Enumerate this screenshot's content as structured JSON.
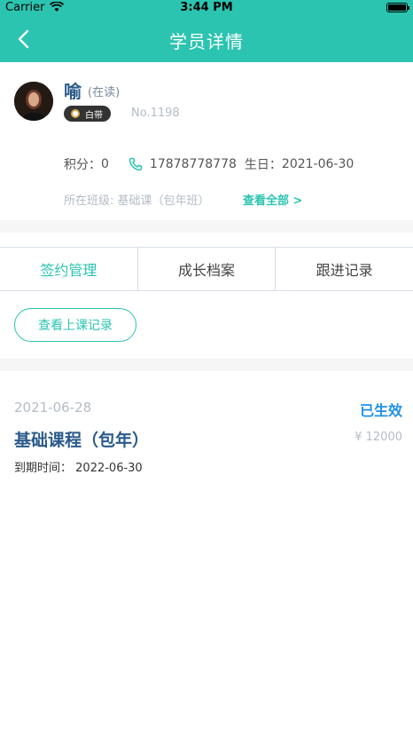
{
  "status_bar": {
    "carrier": "Carrier",
    "time": "3:44 PM"
  },
  "nav": {
    "title": "学员详情"
  },
  "student": {
    "name": "喻",
    "status": "(在读)",
    "belt": "白带",
    "number": "No.1198",
    "points_label": "积分：",
    "points": "0",
    "phone": "17878778778",
    "birthday_label": "生日：",
    "birthday": "2021-06-30",
    "class_label": "所在班级:",
    "class_value": "基础课（包年班）",
    "view_all": "查看全部 >"
  },
  "tabs": [
    {
      "label": "签约管理",
      "active": true
    },
    {
      "label": "成长档案",
      "active": false
    },
    {
      "label": "跟进记录",
      "active": false
    }
  ],
  "record_button": "查看上课记录",
  "contract": {
    "date": "2021-06-28",
    "status": "已生效",
    "title": "基础课程（包年）",
    "price": "¥ 12000",
    "expire_label": "到期时间：",
    "expire_date": "2022-06-30"
  },
  "colors": {
    "accent": "#2bc4b0",
    "title_blue": "#2a5a8a",
    "status_blue": "#1e90e6"
  },
  "icons": {
    "back": "back-chevron-icon",
    "phone": "phone-icon",
    "wifi": "wifi-icon",
    "battery": "battery-icon",
    "belt": "belt-dot-icon"
  }
}
